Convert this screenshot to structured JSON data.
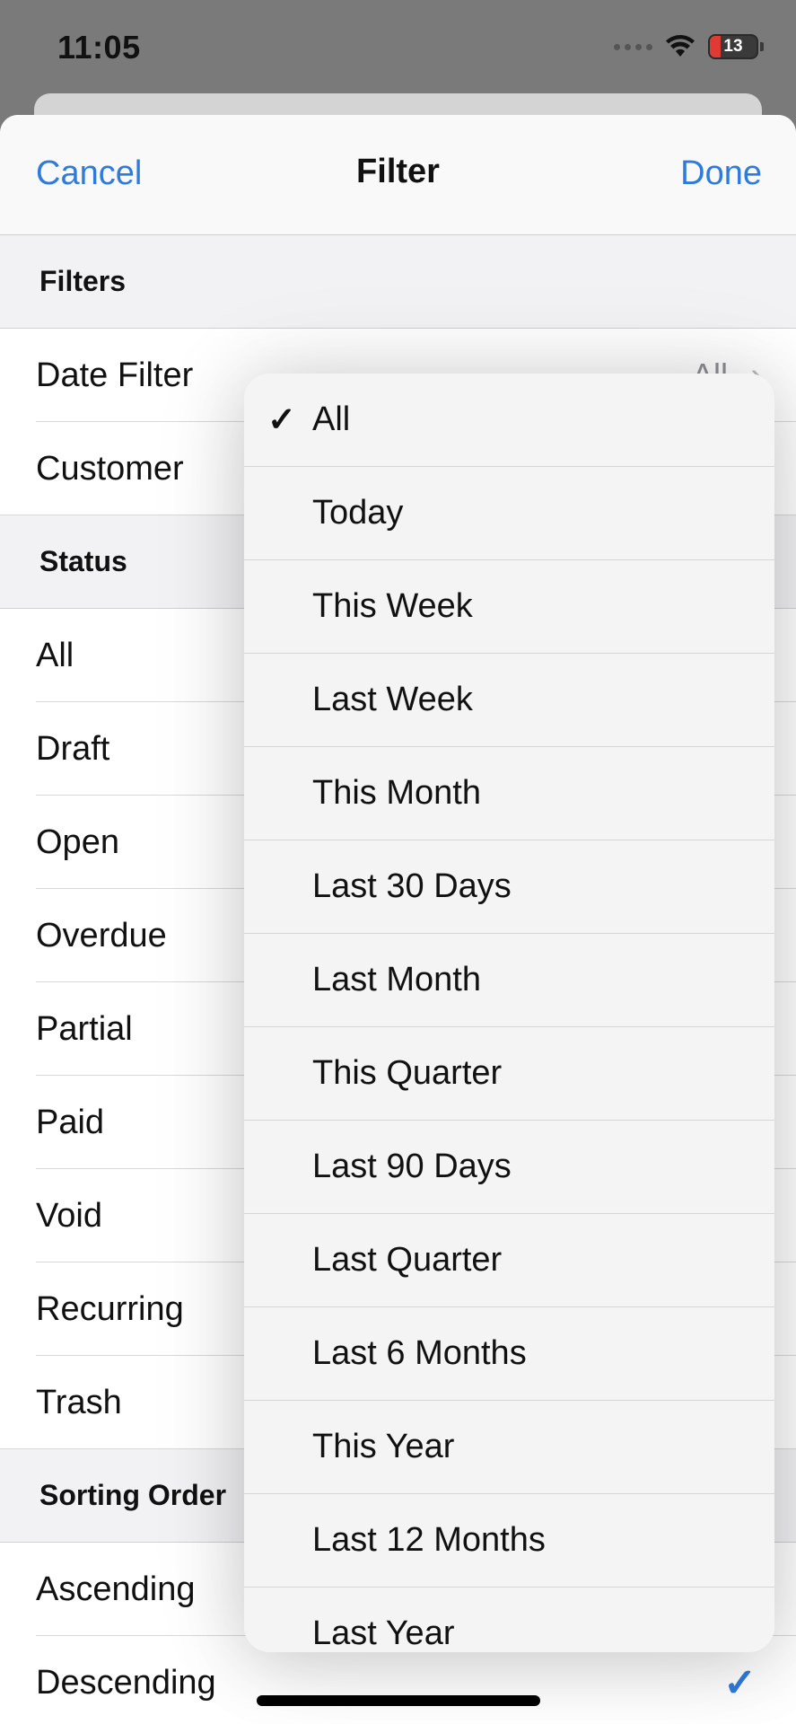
{
  "status": {
    "time": "11:05",
    "battery": "13"
  },
  "nav": {
    "cancel": "Cancel",
    "title": "Filter",
    "done": "Done"
  },
  "filters": {
    "header": "Filters",
    "date_filter": {
      "label": "Date Filter",
      "value": "All"
    },
    "customer": {
      "label": "Customer"
    }
  },
  "status_section": {
    "header": "Status",
    "items": [
      "All",
      "Draft",
      "Open",
      "Overdue",
      "Partial",
      "Paid",
      "Void",
      "Recurring",
      "Trash"
    ]
  },
  "sorting": {
    "header": "Sorting Order",
    "items": [
      "Ascending",
      "Descending"
    ],
    "selected": "Descending"
  },
  "date_menu": {
    "selected": "All",
    "options": [
      "All",
      "Today",
      "This Week",
      "Last Week",
      "This Month",
      "Last 30 Days",
      "Last Month",
      "This Quarter",
      "Last 90 Days",
      "Last Quarter",
      "Last 6 Months",
      "This Year",
      "Last 12 Months",
      "Last Year"
    ]
  },
  "colors": {
    "accent": "#2f7bdc",
    "battery_low": "#e03a35"
  },
  "icons": {
    "checkmark": "checkmark-icon",
    "chevron": "chevron-right-icon",
    "wifi": "wifi-icon",
    "battery": "battery-icon"
  }
}
